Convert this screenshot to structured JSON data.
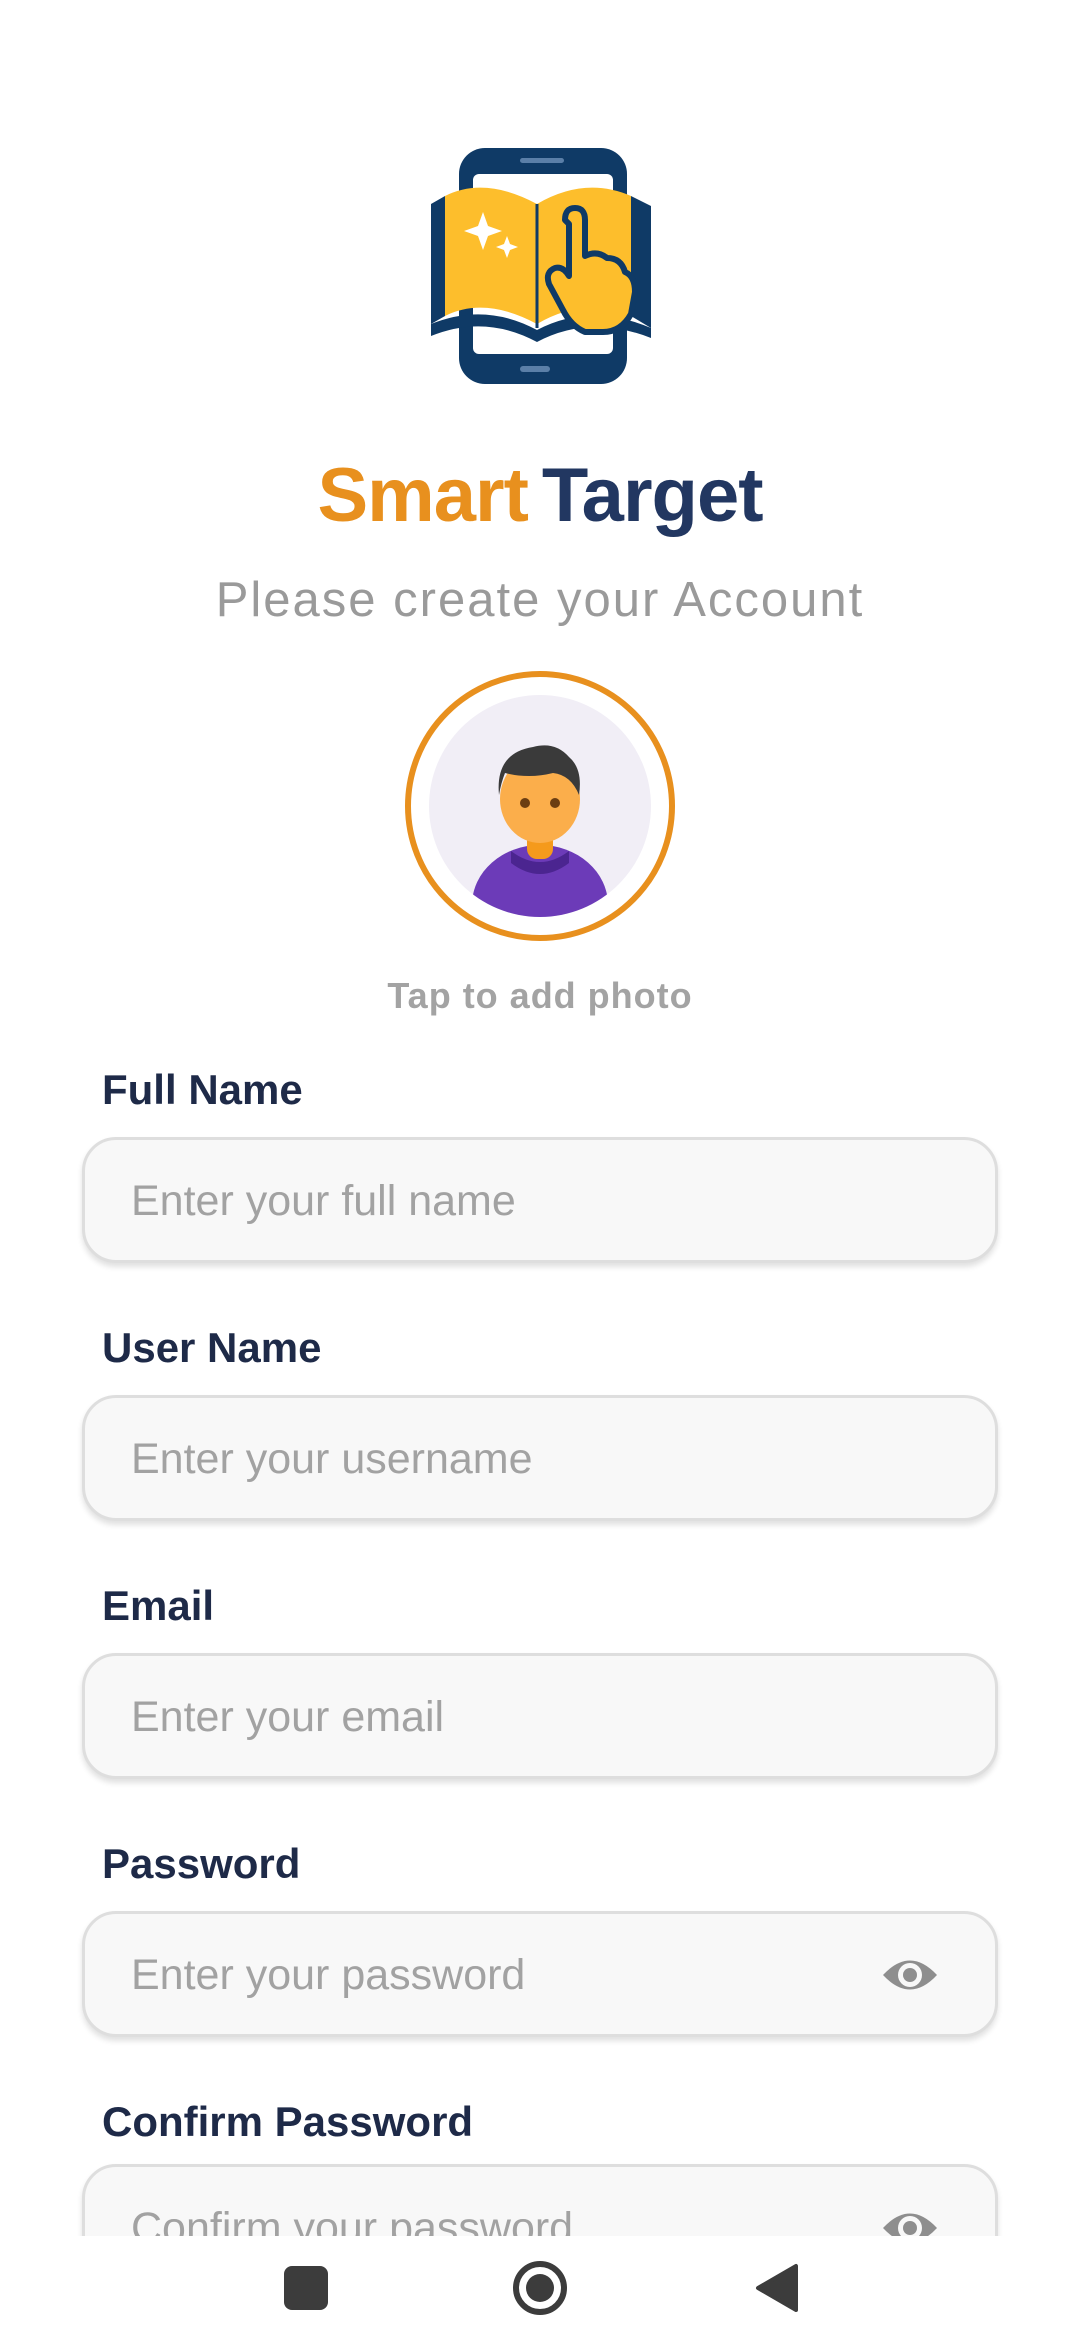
{
  "app": {
    "title_part1": "Smart",
    "title_part2": "Target",
    "subtitle": "Please create your Account",
    "brand_colors": {
      "orange": "#E8901E",
      "navy": "#223761"
    }
  },
  "avatar": {
    "label": "Tap to add photo",
    "icon": "user-avatar-icon"
  },
  "form": {
    "full_name": {
      "label": "Full Name",
      "placeholder": "Enter your full name"
    },
    "user_name": {
      "label": "User Name",
      "placeholder": "Enter your username"
    },
    "email": {
      "label": "Email",
      "placeholder": "Enter your email"
    },
    "password": {
      "label": "Password",
      "placeholder": "Enter your password",
      "toggle_icon": "eye-icon"
    },
    "confirm_password": {
      "label": "Confirm Password",
      "placeholder": "Confirm your password",
      "toggle_icon": "eye-icon"
    }
  },
  "system_nav": {
    "recents_icon": "square-icon",
    "home_icon": "circle-home-icon",
    "back_icon": "triangle-back-icon"
  }
}
